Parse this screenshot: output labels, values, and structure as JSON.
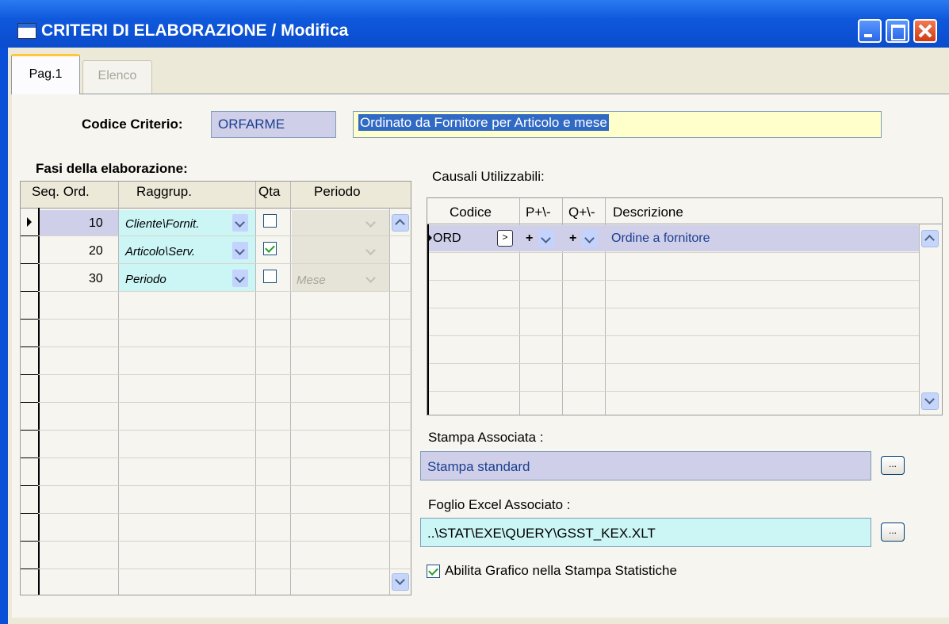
{
  "window": {
    "title": "CRITERI DI ELABORAZIONE / Modifica"
  },
  "tabs": [
    {
      "label": "Pag.1",
      "active": true
    },
    {
      "label": "Elenco",
      "active": false
    }
  ],
  "criterio": {
    "label": "Codice Criterio:",
    "code": "ORFARME",
    "description": "Ordinato da Fornitore per Articolo e mese"
  },
  "fasi": {
    "label": "Fasi della elaborazione:",
    "headers": [
      "Seq. Ord.",
      "Raggrup.",
      "Qta",
      "Periodo"
    ],
    "rows": [
      {
        "seq": "10",
        "raggrup": "Cliente\\Fornit.",
        "qta": false,
        "periodo": ""
      },
      {
        "seq": "20",
        "raggrup": "Articolo\\Serv.",
        "qta": true,
        "periodo": ""
      },
      {
        "seq": "30",
        "raggrup": "Periodo",
        "qta": false,
        "periodo": "Mese"
      }
    ]
  },
  "causali": {
    "label": "Causali Utilizzabili:",
    "headers": [
      "Codice",
      "P+\\-",
      "Q+\\-",
      "Descrizione"
    ],
    "rows": [
      {
        "codice": "ORD",
        "p": "+",
        "q": "+",
        "descrizione": "Ordine a fornitore"
      }
    ]
  },
  "stampa": {
    "label": "Stampa  Associata :",
    "value": "Stampa standard",
    "browse_label": "..."
  },
  "foglio": {
    "label": "Foglio Excel Associato :",
    "value": "..\\STAT\\EXE\\QUERY\\GSST_KEX.XLT",
    "browse_label": "..."
  },
  "grafico": {
    "label": "Abilita Grafico nella Stampa Statistiche",
    "checked": true
  },
  "colors": {
    "titlebar": "#0f58dc",
    "field_highlight": "#cfcfe9",
    "field_yellow": "#ffffcc",
    "field_cyan": "#ccf5f5",
    "selection": "#316ac5"
  }
}
